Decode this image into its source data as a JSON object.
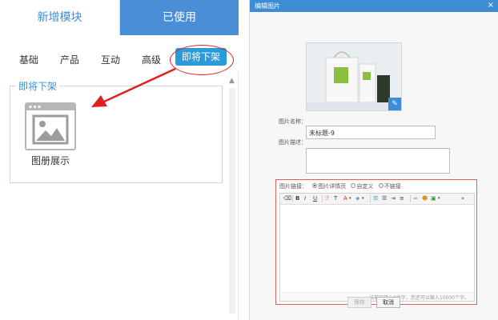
{
  "left_panel": {
    "top_tabs": {
      "new": "新增模块",
      "used": "已使用"
    },
    "categories": [
      "基础",
      "产品",
      "互动",
      "高级",
      "即将下架"
    ],
    "section_title": "即将下架",
    "module_label": "图册展示",
    "colors": {
      "accent": "#3f8fd2",
      "tab_active_bg": "#4a8fd6",
      "category_active_bg": "#2a9ad8",
      "annotation": "#e02020"
    },
    "icons": {
      "module": "album-icon",
      "scroll_up": "scroll-up-icon",
      "annotation_arrow": "red-arrow"
    }
  },
  "dialog": {
    "title": "编辑图片",
    "close": "×",
    "name_label": "图片名称：",
    "name_value": "未标题-9",
    "desc_label": "图片描述：",
    "link_label": "图片链接：",
    "link_options": [
      "图片详情页",
      "自定义",
      "不链接"
    ],
    "link_selected": "图片详情页",
    "editor_count": "当前已输入0个字，您还可以输入10000个字。",
    "save_label": "保存",
    "cancel_label": "取消",
    "toolbar_labels": [
      "B",
      "I",
      "U",
      "T",
      "A"
    ],
    "colors": {
      "header": "#3c8dd3",
      "link_box_border": "#e06060"
    }
  }
}
